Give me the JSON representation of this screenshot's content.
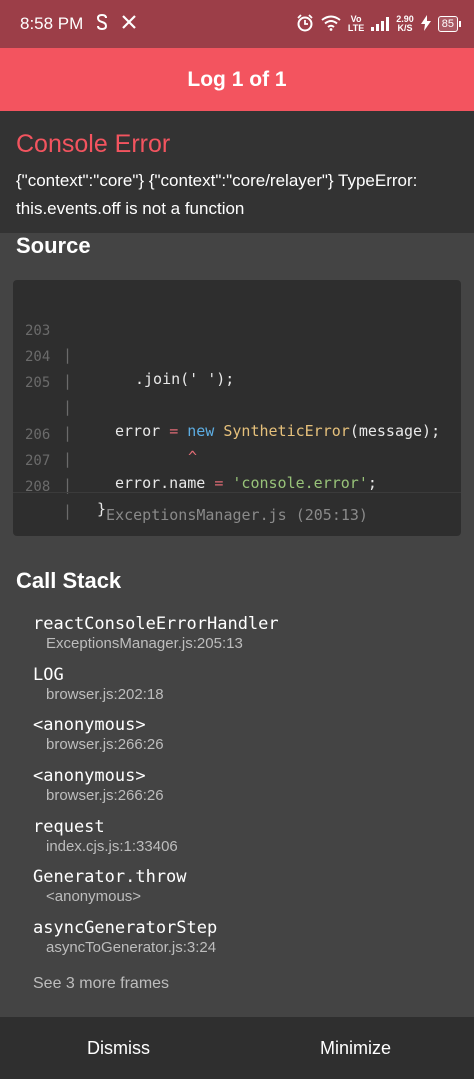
{
  "status_bar": {
    "time": "8:58 PM",
    "left_icons": [
      "notification-s-icon",
      "x-logo-icon"
    ],
    "right_icons": [
      "alarm-icon",
      "wifi-icon",
      "volte-icon",
      "signal-icon"
    ],
    "volte_label_top": "Vo",
    "volte_label_bottom": "LTE",
    "net_speed_value": "2.90",
    "net_speed_unit": "K/S",
    "battery_level": "85"
  },
  "header": {
    "title": "Log 1 of 1"
  },
  "error": {
    "title": "Console Error",
    "message": "{\"context\":\"core\"} {\"context\":\"core/relayer\"} TypeError: this.events.off is not a function"
  },
  "source": {
    "title": "Source",
    "lines": [
      {
        "num": "203",
        "pipe": "|"
      },
      {
        "num": "204",
        "pipe": "|"
      },
      {
        "num": "205",
        "pipe": "|"
      },
      {
        "num": "",
        "pipe": "|"
      },
      {
        "num": "206",
        "pipe": "|"
      },
      {
        "num": "207",
        "pipe": "|"
      },
      {
        "num": "208",
        "pipe": "|"
      }
    ],
    "code": {
      "l203": ".join(' ');",
      "l205_a": "error",
      "l205_b": "=",
      "l205_c": "new",
      "l205_d": "SyntheticError",
      "l205_e": "(message);",
      "caret": "^",
      "l206_a": "error.name",
      "l206_b": "=",
      "l206_c": "'console.error'",
      "l206_d": ";",
      "l207": "}"
    },
    "file_ref": "ExceptionsManager.js (205:13)"
  },
  "call_stack": {
    "title": "Call Stack",
    "frames": [
      {
        "fn": "reactConsoleErrorHandler",
        "loc": "ExceptionsManager.js:205:13"
      },
      {
        "fn": "LOG",
        "loc": "browser.js:202:18"
      },
      {
        "fn": "<anonymous>",
        "loc": "browser.js:266:26"
      },
      {
        "fn": "<anonymous>",
        "loc": "browser.js:266:26"
      },
      {
        "fn": "request",
        "loc": "index.cjs.js:1:33406"
      },
      {
        "fn": "Generator.throw",
        "loc": "<anonymous>"
      },
      {
        "fn": "asyncGeneratorStep",
        "loc": "asyncToGenerator.js:3:24"
      }
    ],
    "more": "See 3 more frames"
  },
  "footer": {
    "dismiss": "Dismiss",
    "minimize": "Minimize"
  },
  "colors": {
    "status_bar": "#9c3e48",
    "header": "#f3545f",
    "error_title": "#f3545f",
    "background": "#444444",
    "panel": "#333333"
  }
}
